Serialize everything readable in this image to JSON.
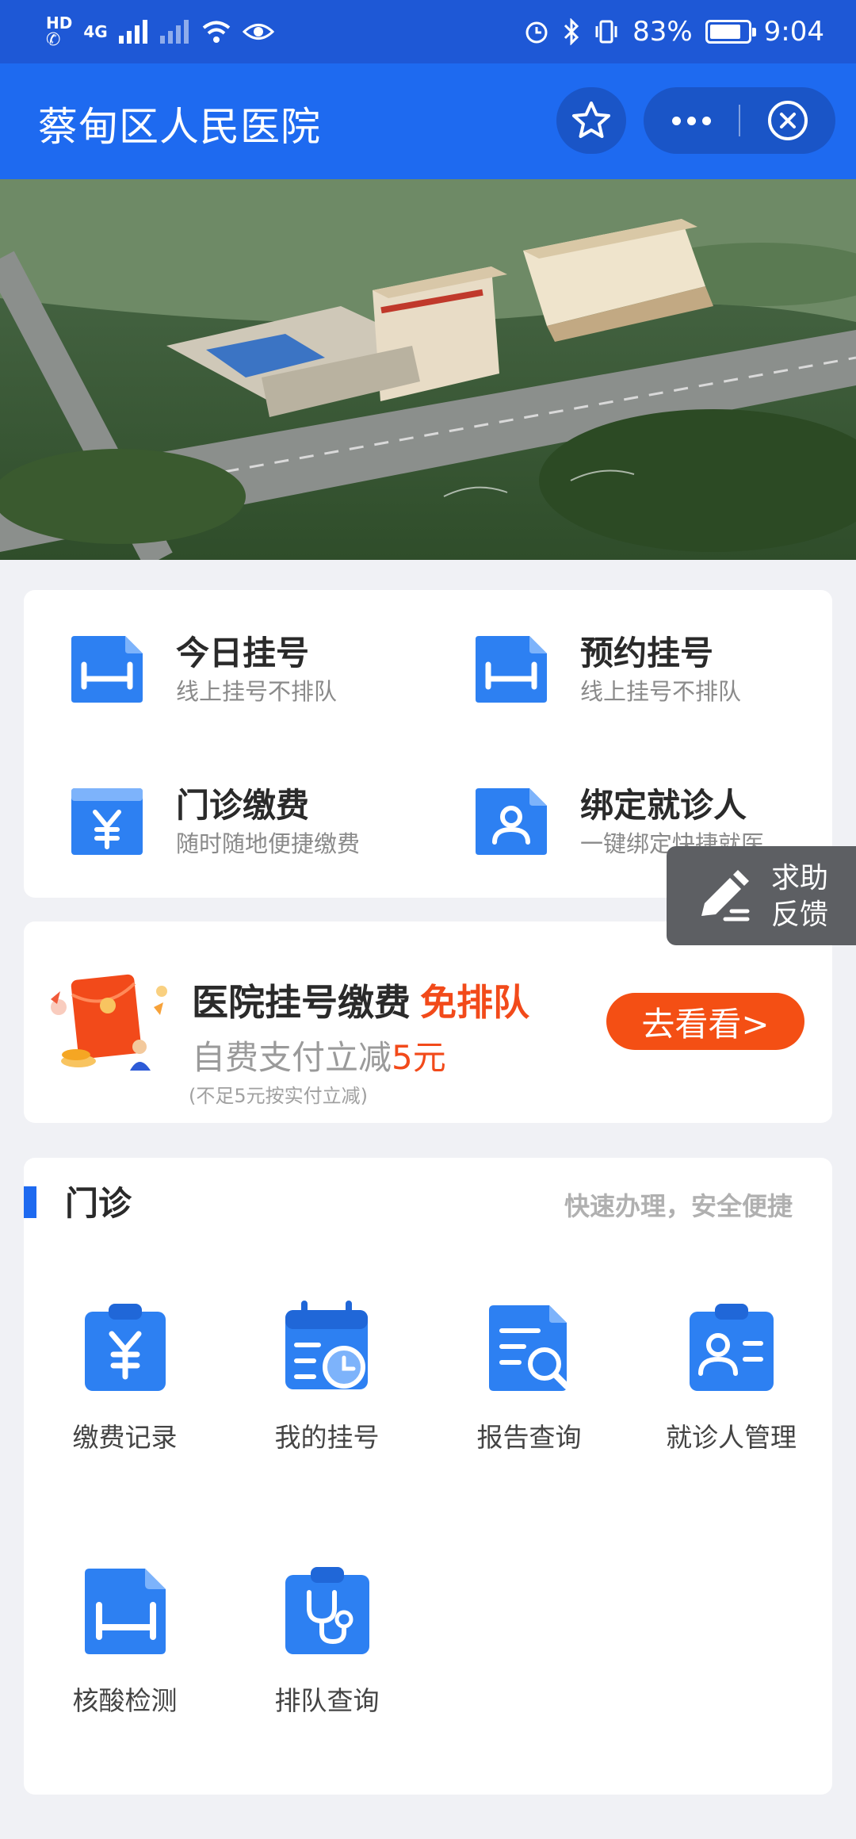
{
  "status_bar": {
    "hd_label": "HD",
    "net_label": "4G",
    "battery_percent": "83%",
    "battery_level": 0.83,
    "time": "9:04"
  },
  "header": {
    "title": "蔡甸区人民医院"
  },
  "quick_actions": [
    {
      "title": "今日挂号",
      "subtitle": "线上挂号不排队",
      "icon": "bed-icon"
    },
    {
      "title": "预约挂号",
      "subtitle": "线上挂号不排队",
      "icon": "bed-icon"
    },
    {
      "title": "门诊缴费",
      "subtitle": "随时随地便捷缴费",
      "icon": "yuan-icon"
    },
    {
      "title": "绑定就诊人",
      "subtitle": "一键绑定快捷就医",
      "icon": "person-icon"
    }
  ],
  "feedback": {
    "line1": "求助",
    "line2": "反馈"
  },
  "promo": {
    "title": "医院挂号缴费",
    "title_highlight": "免排队",
    "subtitle": "自费支付立减",
    "subtitle_highlight": "5元",
    "note": "(不足5元按实付立减)",
    "button": "去看看>"
  },
  "outpatient": {
    "title": "门诊",
    "subtitle": "快速办理，安全便捷",
    "items": [
      {
        "label": "缴费记录",
        "icon": "yuan-clipboard-icon"
      },
      {
        "label": "我的挂号",
        "icon": "calendar-clock-icon"
      },
      {
        "label": "报告查询",
        "icon": "report-search-icon"
      },
      {
        "label": "就诊人管理",
        "icon": "patient-card-icon"
      },
      {
        "label": "核酸检测",
        "icon": "bed-icon"
      },
      {
        "label": "排队查询",
        "icon": "stethoscope-icon"
      }
    ]
  },
  "colors": {
    "brand_blue": "#1e6af0",
    "status_blue": "#1e58d6",
    "accent_orange": "#f24a1a",
    "background": "#f0f1f5"
  }
}
